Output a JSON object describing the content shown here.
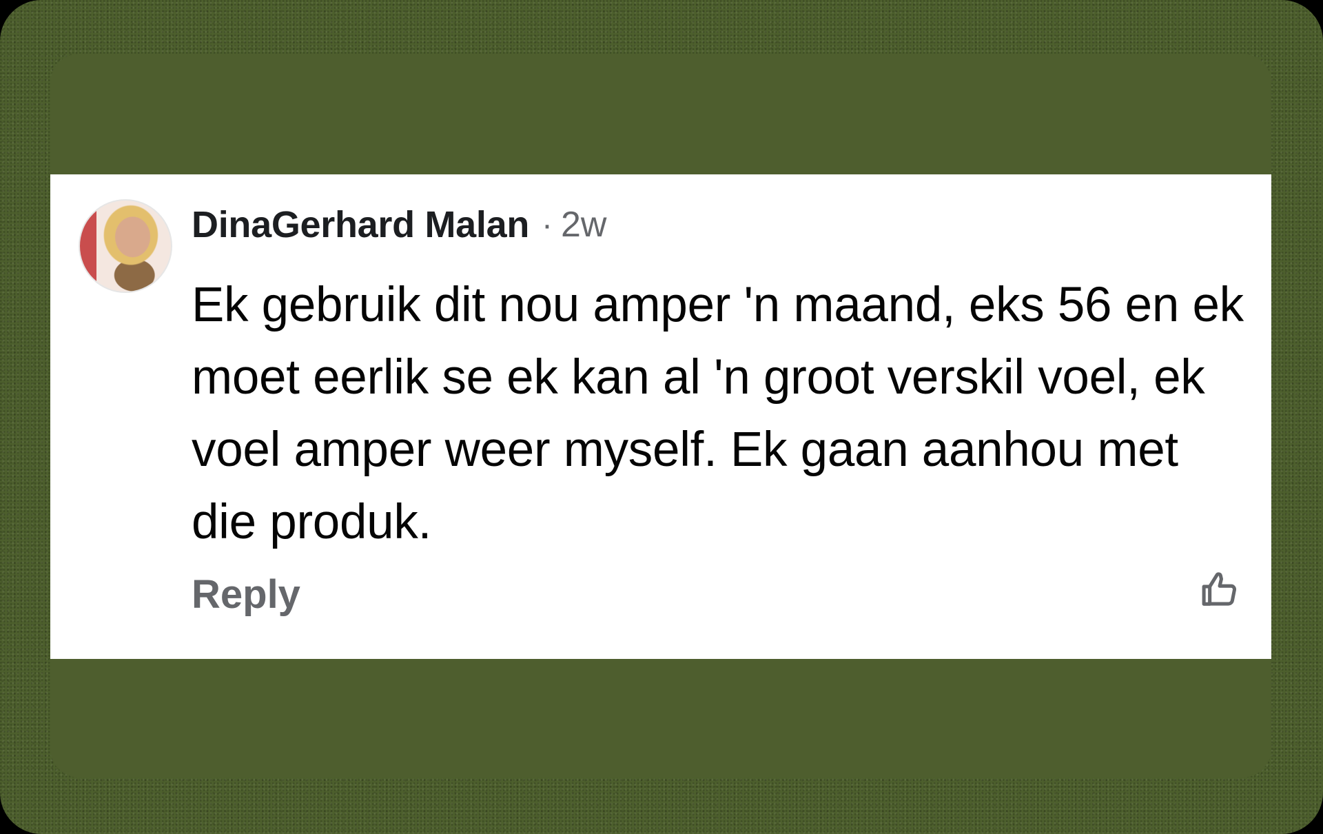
{
  "comment": {
    "author": "DinaGerhard Malan",
    "separator": "·",
    "timestamp": "2w",
    "text": "Ek gebruik dit nou amper 'n maand, eks 56 en ek moet eerlik se ek kan al 'n groot verskil voel, ek voel amper weer myself. Ek gaan aanhou met die produk.",
    "reply_label": "Reply",
    "avatar_icon": "profile-photo",
    "like_icon": "thumbs-up-outline-icon"
  },
  "colors": {
    "background_green": "#4d5f2d",
    "card_background": "#ffffff",
    "author_color": "#1c1e21",
    "secondary_text": "#65676b",
    "body_text": "#050505"
  }
}
